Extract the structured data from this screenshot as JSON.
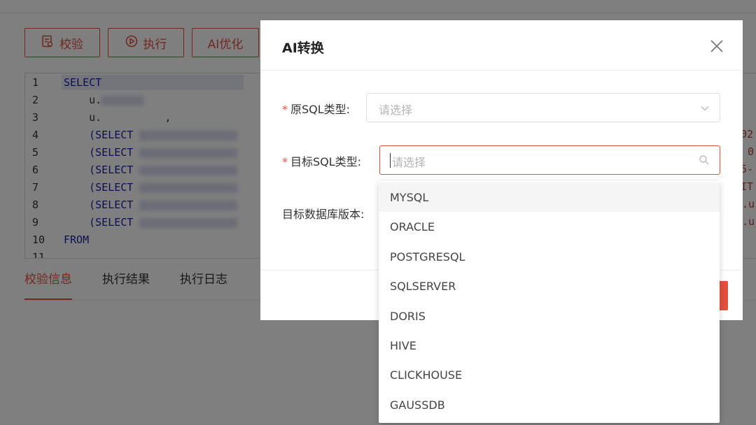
{
  "toolbar": {
    "validate_label": "校验",
    "execute_label": "执行",
    "ai_optimize_label": "AI优化"
  },
  "editor": {
    "line_numbers": [
      "1",
      "2",
      "3",
      "4",
      "5",
      "6",
      "7",
      "8",
      "9",
      "10",
      "11"
    ],
    "lines": [
      {
        "kw": "SELECT",
        "text": ""
      },
      {
        "kw": "",
        "text": "    u."
      },
      {
        "kw": "",
        "text": "    u.          ,"
      },
      {
        "kw": "",
        "text": "    (SELECT"
      },
      {
        "kw": "",
        "text": "    (SELECT"
      },
      {
        "kw": "",
        "text": "    (SELECT"
      },
      {
        "kw": "",
        "text": "    (SELECT"
      },
      {
        "kw": "",
        "text": "    (SELECT"
      },
      {
        "kw": "",
        "text": "    (SELECT"
      },
      {
        "kw": "FROM",
        "text": ""
      }
    ],
    "right_fragments": [
      "02",
      "0",
      "5-",
      "IT",
      ".u",
      ".u"
    ]
  },
  "tabs": [
    {
      "label": "校验信息",
      "active": true
    },
    {
      "label": "执行结果",
      "active": false
    },
    {
      "label": "执行日志",
      "active": false
    }
  ],
  "dialog": {
    "title": "AI转换",
    "source_type_label": "原SQL类型:",
    "source_type_placeholder": "请选择",
    "target_type_label": "目标SQL类型:",
    "target_type_placeholder": "请选择",
    "target_version_label": "目标数据库版本:"
  },
  "dropdown": {
    "options": [
      "MYSQL",
      "ORACLE",
      "POSTGRESQL",
      "SQLSERVER",
      "DORIS",
      "HIVE",
      "CLICKHOUSE",
      "GAUSSDB"
    ],
    "hovered_index": 0
  },
  "colors": {
    "accent": "#e2503f",
    "keyword": "#1a1aa6"
  }
}
